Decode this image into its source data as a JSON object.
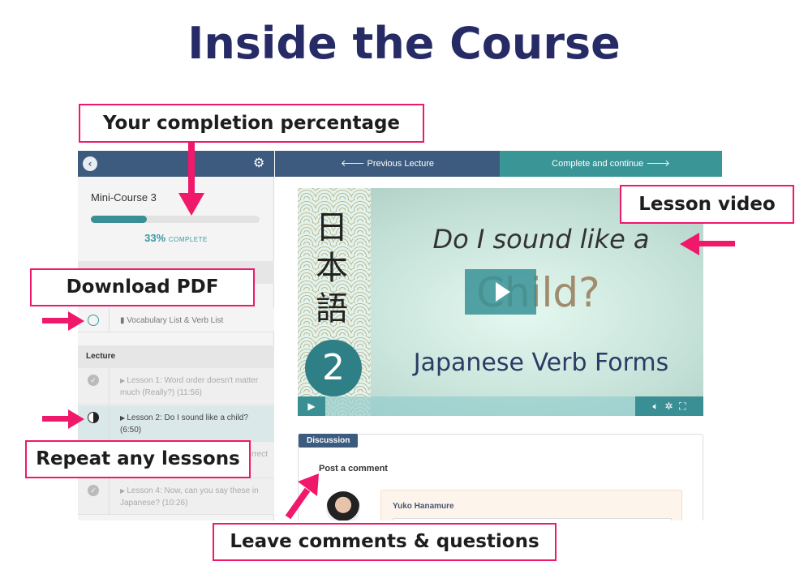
{
  "title": "Inside the Course",
  "header": {
    "previous": "🡐 Previous Lecture",
    "complete": "Complete and continue 🡒"
  },
  "sidebar": {
    "course_title": "Mini-Course 3",
    "progress_percent": 33,
    "progress_value": "33%",
    "progress_label": "COMPLETE",
    "section_label": "Lecture",
    "pdf_item": "Vocabulary List & Verb List",
    "lessons": [
      {
        "label": "Lesson 1: Word order doesn't matter much (Really?) (11:56)",
        "status": "complete"
      },
      {
        "label": "Lesson 2: Do I sound like a child? (6:50)",
        "status": "in-progress"
      },
      {
        "label": "rrect",
        "status": "complete"
      },
      {
        "label": "Lesson 4: Now, can you say these in Japanese? (10:26)",
        "status": "complete"
      }
    ]
  },
  "video": {
    "kanji": [
      "日",
      "本",
      "語"
    ],
    "number": "2",
    "line1": "Do I sound like a",
    "line2": "Child?",
    "line3": "Japanese Verb Forms"
  },
  "discussion": {
    "tab": "Discussion",
    "post_label": "Post a comment",
    "commenter": "Yuko Hanamure"
  },
  "callouts": {
    "completion": "Your completion percentage",
    "pdf": "Download PDF",
    "repeat": "Repeat any lessons",
    "video": "Lesson video",
    "comments": "Leave comments & questions"
  },
  "colors": {
    "accent": "#f0186a",
    "header": "#3d5b7e",
    "teal": "#3a9a9a",
    "title": "#262b66"
  }
}
